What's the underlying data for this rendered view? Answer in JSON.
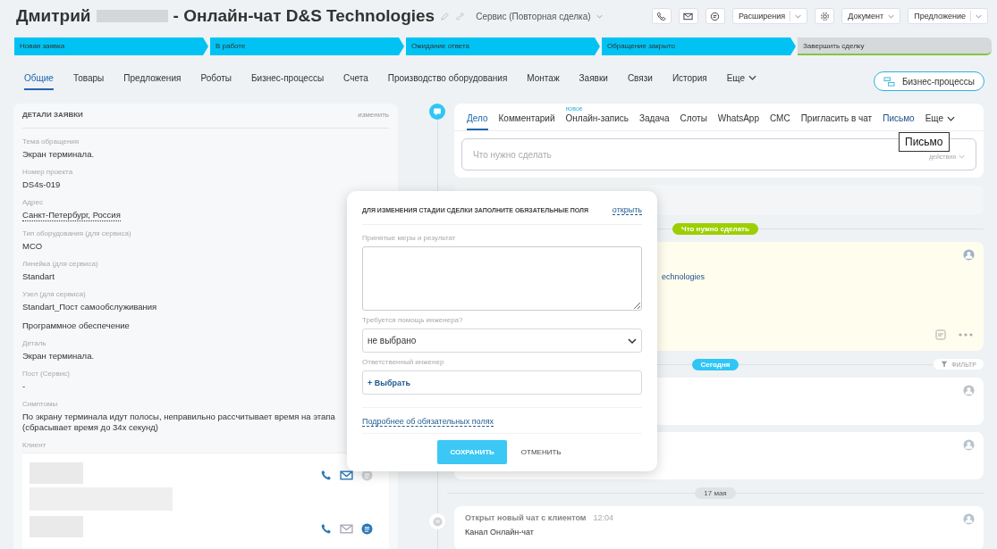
{
  "header": {
    "title_first": "Дмитрий",
    "title_rest": "- Онлайн-чат D&S Technologies",
    "category": "Сервис (Повторная сделка)",
    "buttons": [
      {
        "label": "Расширения",
        "kind": "split"
      },
      {
        "label": "Документ",
        "kind": "menu"
      },
      {
        "label": "Предложение",
        "kind": "split"
      }
    ]
  },
  "stages": [
    {
      "label": "Новая заявка",
      "done": true
    },
    {
      "label": "В работе",
      "done": true
    },
    {
      "label": "Ожидание ответа",
      "done": true
    },
    {
      "label": "Обращение закрыто",
      "done": true
    },
    {
      "label": "Завершить сделку",
      "done": false
    }
  ],
  "tabs": [
    {
      "label": "Общие",
      "selected": true
    },
    {
      "label": "Товары",
      "selected": false
    },
    {
      "label": "Предложения",
      "selected": false
    },
    {
      "label": "Роботы",
      "selected": false
    },
    {
      "label": "Бизнес-процессы",
      "selected": false
    },
    {
      "label": "Счета",
      "selected": false
    },
    {
      "label": "Производство оборудования",
      "selected": false
    },
    {
      "label": "Монтаж",
      "selected": false
    },
    {
      "label": "Заявки",
      "selected": false
    },
    {
      "label": "Связи",
      "selected": false
    },
    {
      "label": "История",
      "selected": false
    },
    {
      "label": "Еще",
      "selected": false
    }
  ],
  "bp_button": "Бизнес-процессы",
  "details": {
    "title": "ДЕТАЛИ ЗАЯВКИ",
    "edit": "изменить",
    "fields": [
      {
        "label": "Тема обращения",
        "lines": [
          "Экран терминала."
        ],
        "kind": "text"
      },
      {
        "label": "Номер проекта",
        "lines": [
          "DS4s-019"
        ],
        "kind": "text"
      },
      {
        "label": "Адрес",
        "lines": [
          "Санкт-Петербург, Россия"
        ],
        "kind": "link"
      },
      {
        "label": "Тип оборудования (для сервиса)",
        "lines": [
          "MCO"
        ],
        "kind": "text"
      },
      {
        "label": "Линейка (для сервиса)",
        "lines": [
          "Standart"
        ],
        "kind": "text"
      },
      {
        "label": "Узел (для сервиса)",
        "lines": [
          "Standart_Пост самообслуживания"
        ],
        "kind": "text"
      },
      {
        "lines": [
          "Программное обеспечение"
        ],
        "kind": "text"
      },
      {
        "label": "Деталь",
        "lines": [
          "Экран терминала."
        ],
        "kind": "text"
      },
      {
        "label": "Пост (Сервис)",
        "lines": [
          "-"
        ],
        "kind": "text"
      },
      {
        "label": "Симптомы",
        "lines": [
          "По экрану терминала идут полосы, неправильно рассчитывает время на этапа",
          "(сбрасывает время до 34х секунд)"
        ],
        "kind": "text"
      }
    ],
    "client_label": "Клиент",
    "contacts": [
      {
        "mail_active": true,
        "chat_active": false
      },
      {
        "mail_active": false,
        "chat_active": true
      }
    ]
  },
  "activity": {
    "tabs": [
      {
        "label": "Дело",
        "selected": true,
        "kind": "plain"
      },
      {
        "label": "Комментарий",
        "selected": false,
        "kind": "plain"
      },
      {
        "label": "Онлайн-запись",
        "selected": false,
        "kind": "new",
        "badge": "новое"
      },
      {
        "label": "Задача",
        "selected": false,
        "kind": "plain"
      },
      {
        "label": "Слоты",
        "selected": false,
        "kind": "plain"
      },
      {
        "label": "WhatsApp",
        "selected": false,
        "kind": "plain"
      },
      {
        "label": "СМС",
        "selected": false,
        "kind": "plain"
      },
      {
        "label": "Пригласить в чат",
        "selected": false,
        "kind": "plain"
      },
      {
        "label": "Письмо",
        "selected": false,
        "kind": "hover"
      },
      {
        "label": "Еще",
        "selected": false,
        "kind": "more"
      }
    ],
    "placeholder": "Что нужно сделать",
    "actions": "действия",
    "tooltip": "Письмо"
  },
  "timeline": {
    "todo_badge": "Что нужно сделать",
    "todo_link": "echnologies",
    "today_badge": "Сегодня",
    "filter": "ФИЛЬТР",
    "date_badge": "17 мая",
    "chat_event": {
      "title": "Открыт новый чат с клиентом",
      "time": "12:04",
      "text": "Канал Онлайн-чат"
    }
  },
  "modal": {
    "title": "ДЛЯ ИЗМЕНЕНИЯ СТАДИИ СДЕЛКИ ЗАПОЛНИТЕ ОБЯЗАТЕЛЬНЫЕ ПОЛЯ",
    "open_link": "открыть",
    "result_label": "Принятые меры и результат",
    "help_label": "Требуется помощь инженера?",
    "help_value": "не выбрано",
    "engineer_label": "Ответственный инженер",
    "engineer_add": "+ Выбрать",
    "more_link": "Подробнее об обязательных полях",
    "save": "СОХРАНИТЬ",
    "cancel": "ОТМЕНИТЬ"
  }
}
